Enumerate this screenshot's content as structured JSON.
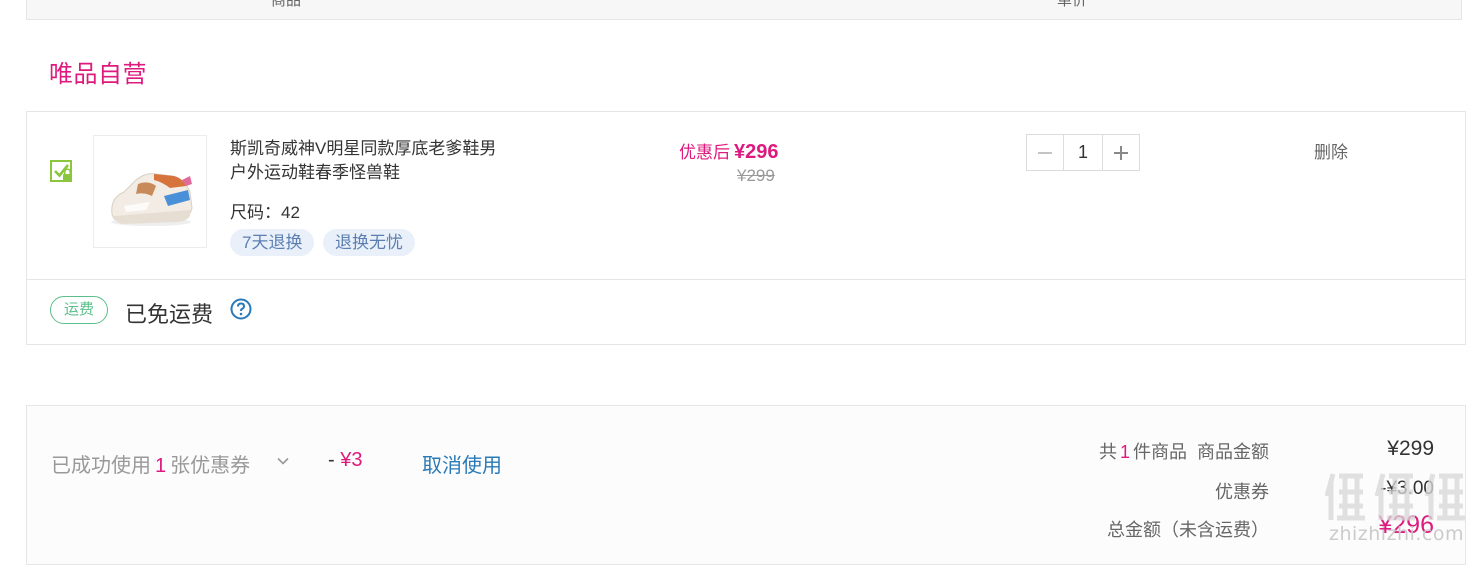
{
  "header": {
    "col_product": "商品",
    "col_price": "单价"
  },
  "store": {
    "title": "唯品自营"
  },
  "item": {
    "name": "斯凯奇威神V明星同款厚底老爹鞋男户外运动鞋春季怪兽鞋",
    "size": "尺码：42",
    "tags": [
      "7天退换",
      "退换无忧"
    ],
    "price_after_label": "优惠后",
    "price_after": "¥296",
    "price_original": "¥299",
    "quantity": "1",
    "delete_label": "删除",
    "checked": true
  },
  "shipping": {
    "badge": "运费",
    "text": "已免运费",
    "help_icon": "question-circle-icon"
  },
  "coupon": {
    "prefix": "已成功使用",
    "count": "1",
    "suffix": "张优惠券",
    "amount_prefix": "-",
    "amount": "¥3",
    "cancel_label": "取消使用"
  },
  "summary": {
    "count_prefix": "共",
    "count": "1",
    "count_suffix": "件商品",
    "goods_label": "商品金额",
    "goods_value": "¥299",
    "coupon_label": "优惠券",
    "coupon_value": "-¥3.00",
    "total_label": "总金额（未含运费）",
    "total_value": "¥296"
  },
  "watermark": {
    "text": "zhizhizhi.com"
  },
  "colors": {
    "accent_pink": "#de1a7e",
    "link_blue": "#2a7ab8",
    "ship_green": "#5bbf8a",
    "check_green": "#8cc63f"
  }
}
